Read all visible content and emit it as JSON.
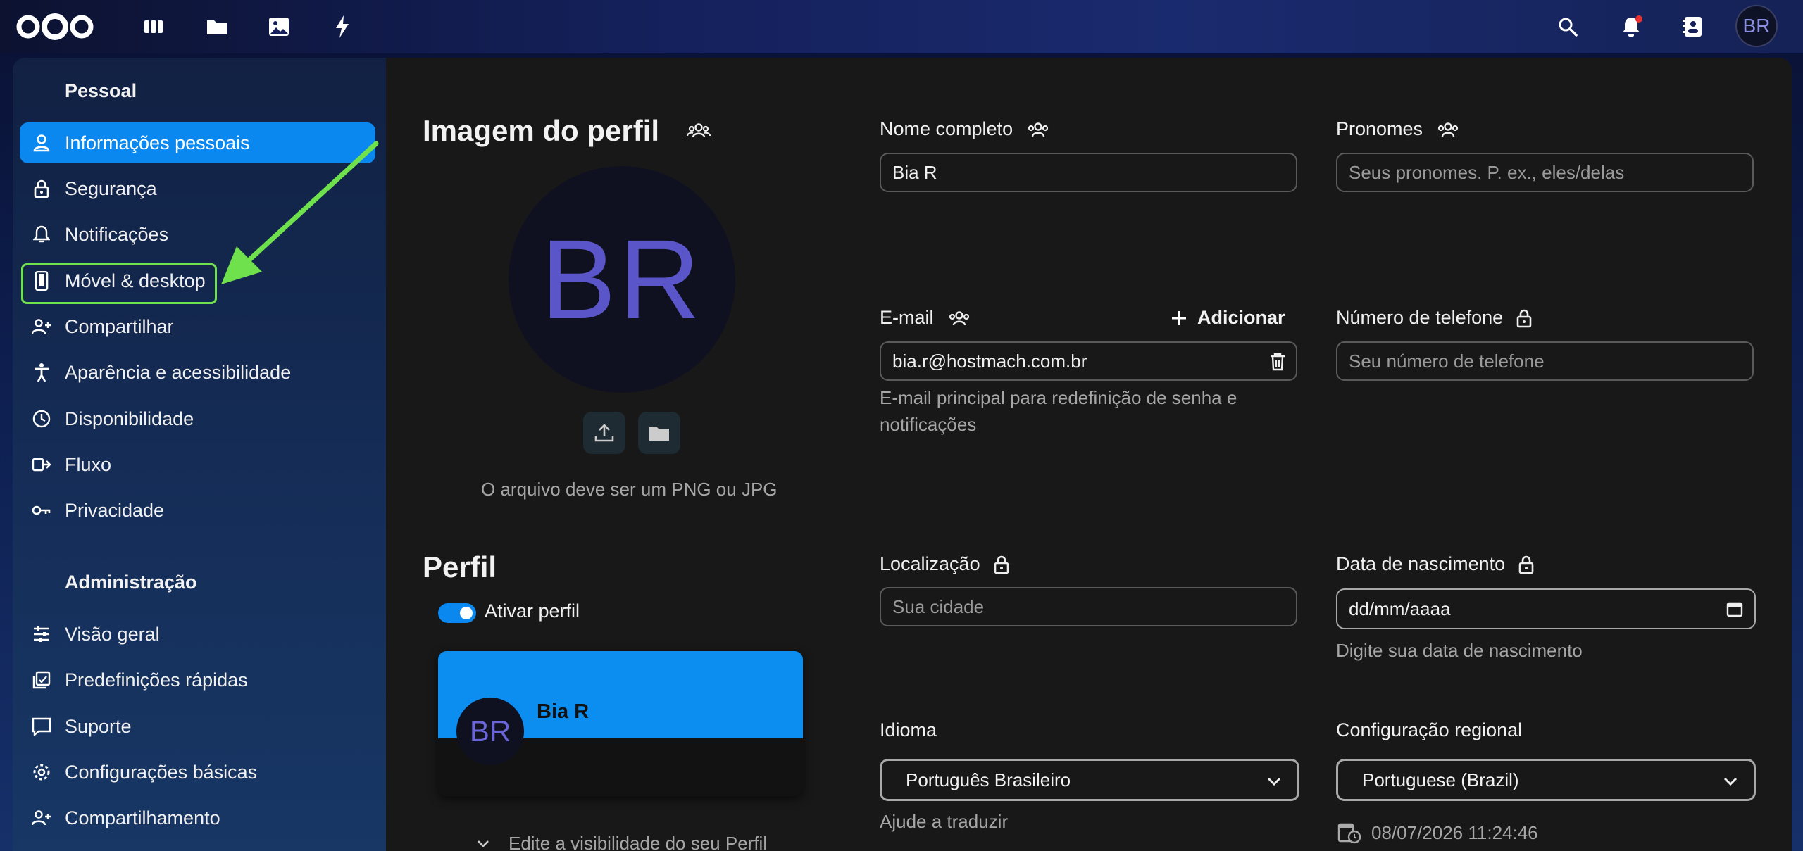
{
  "topbar": {
    "avatar_initials": "BR",
    "icons": [
      "nextcloud-logo",
      "dashboard-icon",
      "files-icon",
      "photos-icon",
      "activity-icon",
      "search-icon",
      "notifications-icon",
      "contacts-icon"
    ]
  },
  "sidebar": {
    "personal_title": "Pessoal",
    "personal_items": [
      {
        "label": "Informações pessoais",
        "icon": "person-icon",
        "active": true
      },
      {
        "label": "Segurança",
        "icon": "lock-icon"
      },
      {
        "label": "Notificações",
        "icon": "bell-icon"
      },
      {
        "label": "Móvel & desktop",
        "icon": "phone-icon"
      },
      {
        "label": "Compartilhar",
        "icon": "share-person-icon"
      },
      {
        "label": "Aparência e acessibilidade",
        "icon": "accessibility-icon"
      },
      {
        "label": "Disponibilidade",
        "icon": "clock-icon"
      },
      {
        "label": "Fluxo",
        "icon": "flow-icon"
      },
      {
        "label": "Privacidade",
        "icon": "key-icon"
      }
    ],
    "admin_title": "Administração",
    "admin_items": [
      {
        "label": "Visão geral",
        "icon": "tune-icon"
      },
      {
        "label": "Predefinições rápidas",
        "icon": "presets-icon"
      },
      {
        "label": "Suporte",
        "icon": "support-icon"
      },
      {
        "label": "Configurações básicas",
        "icon": "gear-icon"
      },
      {
        "label": "Compartilhamento",
        "icon": "share-person-icon"
      }
    ],
    "accent_color": "#0b88f0",
    "annotation_color": "#6fe14d"
  },
  "profile_image": {
    "title": "Imagem do perfil",
    "avatar_initials": "BR",
    "hint": "O arquivo deve ser um PNG ou JPG"
  },
  "profile": {
    "title": "Perfil",
    "enable_label": "Ativar perfil",
    "enabled": true,
    "card_name": "Bia R",
    "card_initials": "BR",
    "visibility_label": "Edite a visibilidade do seu Perfil"
  },
  "fields": {
    "full_name": {
      "label": "Nome completo",
      "value": "Bia R"
    },
    "pronouns": {
      "label": "Pronomes",
      "placeholder": "Seus pronomes. P. ex., eles/delas"
    },
    "email": {
      "label": "E-mail",
      "add_label": "Adicionar",
      "value": "bia.r@hostmach.com.br",
      "hint": "E-mail principal para redefinição de senha e notificações"
    },
    "phone": {
      "label": "Número de telefone",
      "placeholder": "Seu número de telefone"
    },
    "location": {
      "label": "Localização",
      "placeholder": "Sua cidade"
    },
    "birthdate": {
      "label": "Data de nascimento",
      "placeholder": "dd/mm/aaaa",
      "hint": "Digite sua data de nascimento"
    },
    "language": {
      "label": "Idioma",
      "value": "Português Brasileiro",
      "hint": "Ajude a traduzir"
    },
    "locale": {
      "label": "Configuração regional",
      "value": "Portuguese (Brazil)",
      "time": "08/07/2026 11:24:46"
    }
  }
}
